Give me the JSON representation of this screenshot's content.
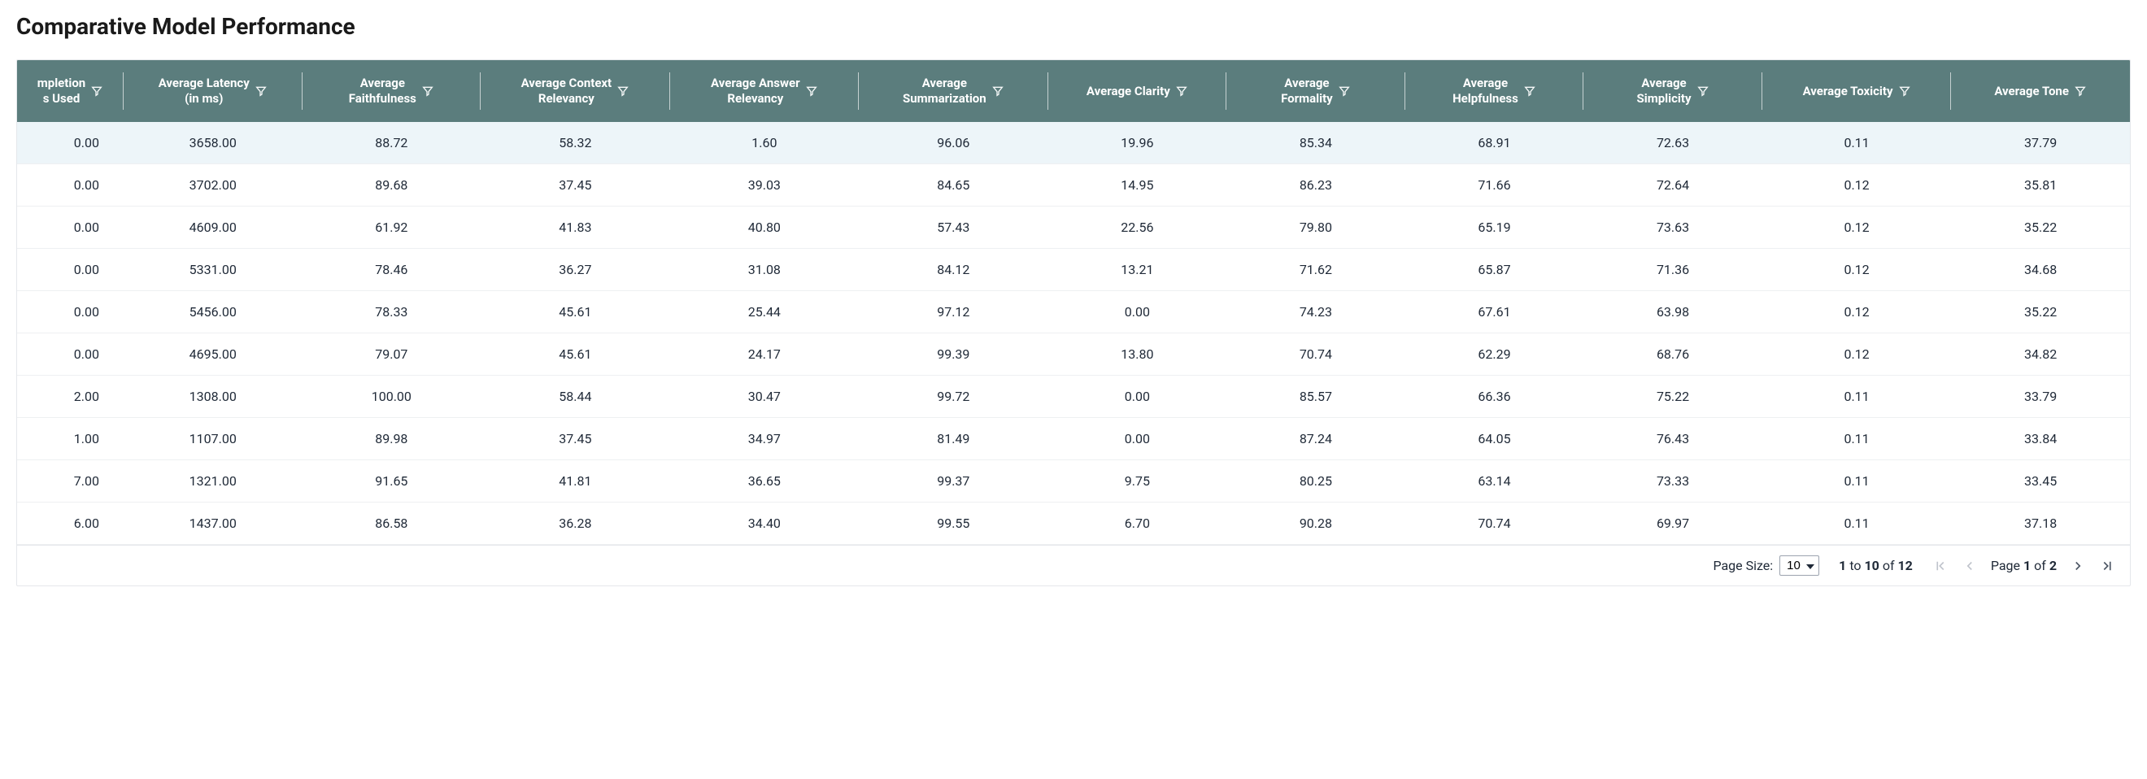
{
  "title": "Comparative Model Performance",
  "columns": [
    {
      "key": "completion",
      "label": "mpletion\ns Used",
      "width": 90,
      "align": "right"
    },
    {
      "key": "latency",
      "label": "Average Latency\n(in ms)",
      "width": 170
    },
    {
      "key": "faith",
      "label": "Average\nFaithfulness",
      "width": 170
    },
    {
      "key": "ctx",
      "label": "Average Context\nRelevancy",
      "width": 180
    },
    {
      "key": "ans",
      "label": "Average Answer\nRelevancy",
      "width": 180
    },
    {
      "key": "summ",
      "label": "Average\nSummarization",
      "width": 180
    },
    {
      "key": "clarity",
      "label": "Average Clarity",
      "width": 170
    },
    {
      "key": "form",
      "label": "Average\nFormality",
      "width": 170
    },
    {
      "key": "help",
      "label": "Average\nHelpfulness",
      "width": 170
    },
    {
      "key": "simp",
      "label": "Average\nSimplicity",
      "width": 170
    },
    {
      "key": "tox",
      "label": "Average Toxicity",
      "width": 180
    },
    {
      "key": "tone",
      "label": "Average Tone",
      "width": 170
    }
  ],
  "rows": [
    {
      "completion": "0.00",
      "latency": "3658.00",
      "faith": "88.72",
      "ctx": "58.32",
      "ans": "1.60",
      "summ": "96.06",
      "clarity": "19.96",
      "form": "85.34",
      "help": "68.91",
      "simp": "72.63",
      "tox": "0.11",
      "tone": "37.79",
      "highlight": true
    },
    {
      "completion": "0.00",
      "latency": "3702.00",
      "faith": "89.68",
      "ctx": "37.45",
      "ans": "39.03",
      "summ": "84.65",
      "clarity": "14.95",
      "form": "86.23",
      "help": "71.66",
      "simp": "72.64",
      "tox": "0.12",
      "tone": "35.81"
    },
    {
      "completion": "0.00",
      "latency": "4609.00",
      "faith": "61.92",
      "ctx": "41.83",
      "ans": "40.80",
      "summ": "57.43",
      "clarity": "22.56",
      "form": "79.80",
      "help": "65.19",
      "simp": "73.63",
      "tox": "0.12",
      "tone": "35.22"
    },
    {
      "completion": "0.00",
      "latency": "5331.00",
      "faith": "78.46",
      "ctx": "36.27",
      "ans": "31.08",
      "summ": "84.12",
      "clarity": "13.21",
      "form": "71.62",
      "help": "65.87",
      "simp": "71.36",
      "tox": "0.12",
      "tone": "34.68"
    },
    {
      "completion": "0.00",
      "latency": "5456.00",
      "faith": "78.33",
      "ctx": "45.61",
      "ans": "25.44",
      "summ": "97.12",
      "clarity": "0.00",
      "form": "74.23",
      "help": "67.61",
      "simp": "63.98",
      "tox": "0.12",
      "tone": "35.22"
    },
    {
      "completion": "0.00",
      "latency": "4695.00",
      "faith": "79.07",
      "ctx": "45.61",
      "ans": "24.17",
      "summ": "99.39",
      "clarity": "13.80",
      "form": "70.74",
      "help": "62.29",
      "simp": "68.76",
      "tox": "0.12",
      "tone": "34.82"
    },
    {
      "completion": "2.00",
      "latency": "1308.00",
      "faith": "100.00",
      "ctx": "58.44",
      "ans": "30.47",
      "summ": "99.72",
      "clarity": "0.00",
      "form": "85.57",
      "help": "66.36",
      "simp": "75.22",
      "tox": "0.11",
      "tone": "33.79"
    },
    {
      "completion": "1.00",
      "latency": "1107.00",
      "faith": "89.98",
      "ctx": "37.45",
      "ans": "34.97",
      "summ": "81.49",
      "clarity": "0.00",
      "form": "87.24",
      "help": "64.05",
      "simp": "76.43",
      "tox": "0.11",
      "tone": "33.84"
    },
    {
      "completion": "7.00",
      "latency": "1321.00",
      "faith": "91.65",
      "ctx": "41.81",
      "ans": "36.65",
      "summ": "99.37",
      "clarity": "9.75",
      "form": "80.25",
      "help": "63.14",
      "simp": "73.33",
      "tox": "0.11",
      "tone": "33.45"
    },
    {
      "completion": "6.00",
      "latency": "1437.00",
      "faith": "86.58",
      "ctx": "36.28",
      "ans": "34.40",
      "summ": "99.55",
      "clarity": "6.70",
      "form": "90.28",
      "help": "70.74",
      "simp": "69.97",
      "tox": "0.11",
      "tone": "37.18"
    }
  ],
  "footer": {
    "page_size_label": "Page Size:",
    "page_size_value": "10",
    "range_from": "1",
    "range_to": "10",
    "range_of_label": "of",
    "total": "12",
    "page_label_prefix": "Page",
    "page_current": "1",
    "page_of_label": "of",
    "page_total": "2"
  }
}
